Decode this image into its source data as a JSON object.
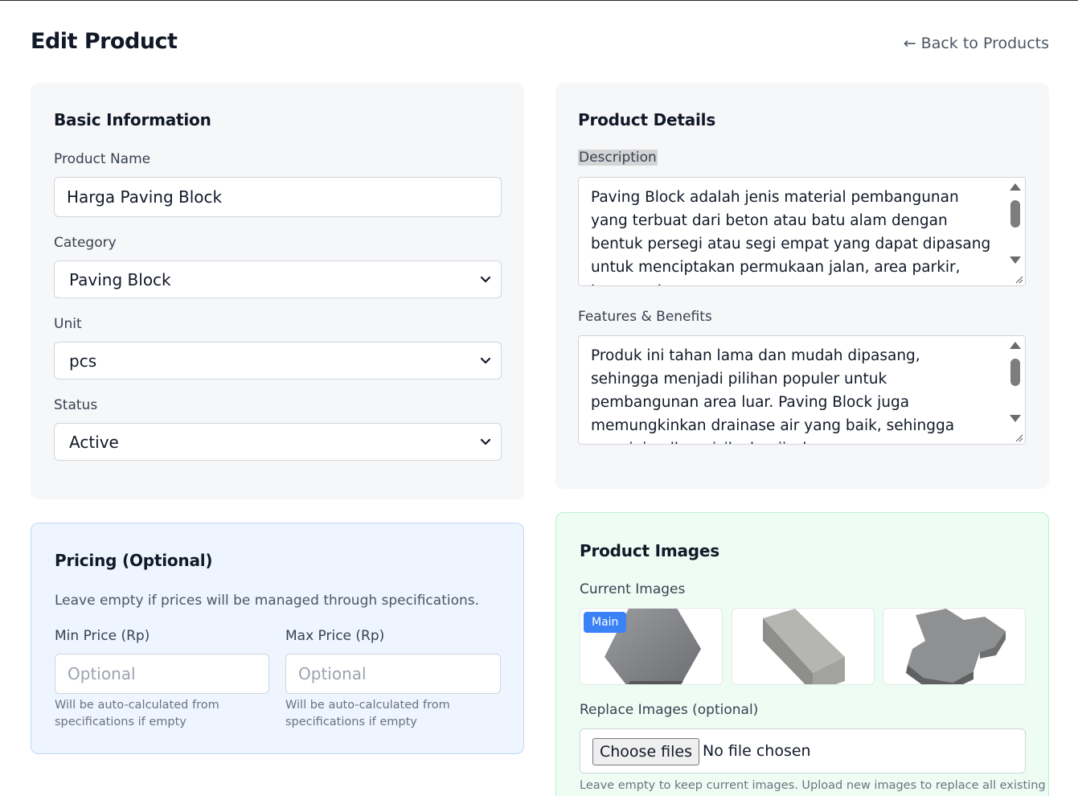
{
  "page": {
    "title": "Edit Product",
    "back_link": "← Back to Products"
  },
  "basic_info": {
    "title": "Basic Information",
    "product_name_label": "Product Name",
    "product_name_value": "Harga Paving Block",
    "category_label": "Category",
    "category_value": "Paving Block",
    "unit_label": "Unit",
    "unit_value": "pcs",
    "status_label": "Status",
    "status_value": "Active"
  },
  "pricing": {
    "title": "Pricing (Optional)",
    "note": "Leave empty if prices will be managed through specifications.",
    "min_label": "Min Price (Rp)",
    "min_placeholder": "Optional",
    "min_hint_1": "Will be auto-calculated from",
    "min_hint_2": "specifications if empty",
    "max_label": "Max Price (Rp)",
    "max_placeholder": "Optional",
    "max_hint_1": "Will be auto-calculated from",
    "max_hint_2": "specifications if empty"
  },
  "details": {
    "title": "Product Details",
    "description_label": "Description",
    "description_value": "Paving Block adalah jenis material pembangunan yang terbuat dari beton atau batu alam dengan bentuk persegi atau segi empat yang dapat dipasang untuk menciptakan permukaan jalan, area parkir, taman, atau",
    "features_label": "Features & Benefits",
    "features_value": "Produk ini tahan lama dan mudah dipasang, sehingga menjadi pilihan populer untuk pembangunan area luar. Paving Block juga memungkinkan drainase air yang baik, sehingga meminimalkan risiko banjir dan"
  },
  "images": {
    "title": "Product Images",
    "current_label": "Current Images",
    "main_badge": "Main",
    "replace_label": "Replace Images (optional)",
    "choose_button": "Choose files",
    "file_status": "No file chosen",
    "hint": "Leave empty to keep current images. Upload new images to replace all existing"
  },
  "colors": {
    "accent_blue": "#3b82f6",
    "pricing_bg": "#eef5ff",
    "images_bg": "#edfdf3",
    "card_gray": "#f6f7f9"
  },
  "icons": [
    "chevron-down-icon",
    "scroll-up-icon",
    "scroll-down-icon",
    "resize-handle-icon"
  ]
}
